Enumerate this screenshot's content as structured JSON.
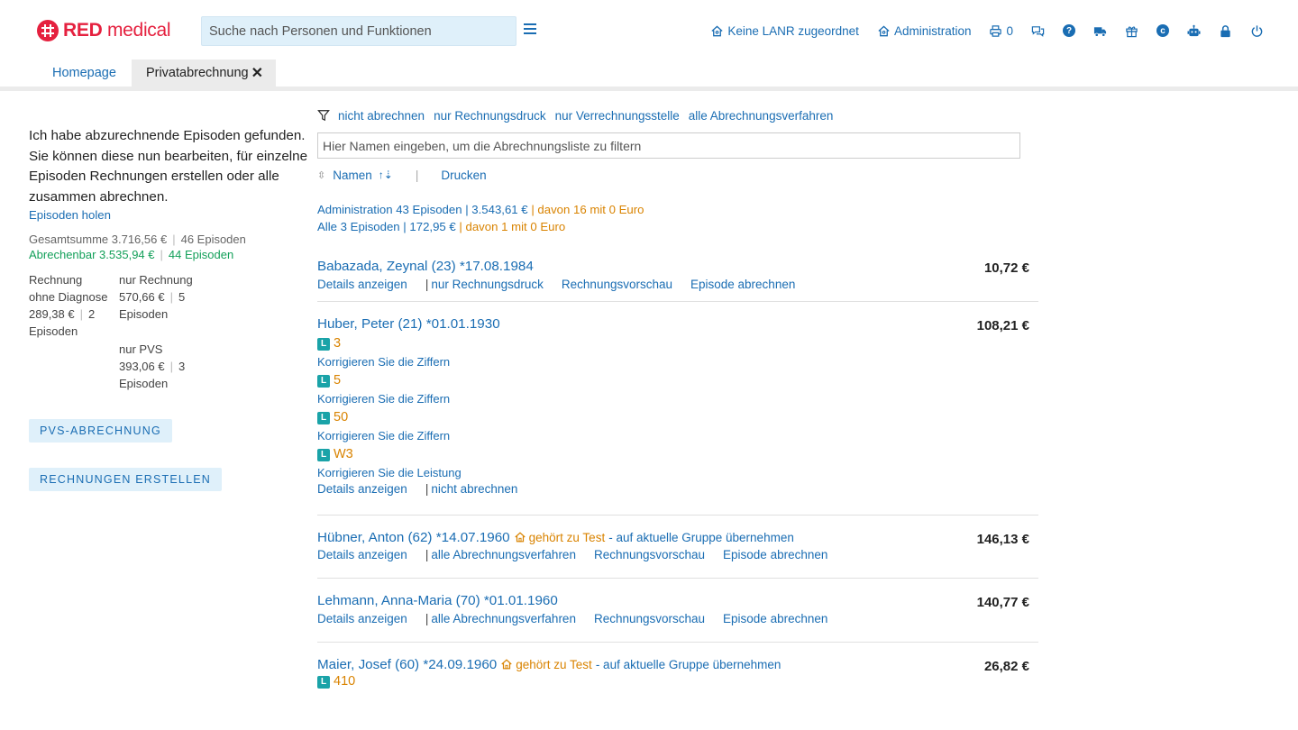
{
  "app": {
    "logo_bold": "RED",
    "logo_light": " medical"
  },
  "search": {
    "placeholder": "Suche nach Personen und Funktionen"
  },
  "toolbar": {
    "lanr": "Keine LANR zugeordnet",
    "administration": "Administration",
    "print_count": "0"
  },
  "tabs": [
    {
      "label": "Homepage"
    },
    {
      "label": "Privatabrechnung"
    }
  ],
  "left": {
    "intro": "Ich habe abzurechnende Episoden gefunden. Sie können diese nun bearbeiten, für einzelne Episoden Rechnungen erstellen oder alle zusammen abrechnen.",
    "get_episodes": "Episoden holen",
    "total_label": "Gesamtsumme 3.716,56 €",
    "total_episodes": "46 Episoden",
    "billable_label": "Abrechenbar 3.535,94 €",
    "billable_episodes": "44 Episoden",
    "col1": {
      "label_l1": "Rechnung",
      "label_l2": "ohne Diagnose",
      "amount": "289,38 €",
      "count": "2",
      "unit": "Episoden"
    },
    "col2a": {
      "label": "nur Rechnung",
      "amount": "570,66 €",
      "count": "5",
      "unit": "Episoden"
    },
    "col2b": {
      "label": "nur PVS",
      "amount": "393,06 €",
      "count": "3",
      "unit": "Episoden"
    },
    "btn_pvs": "PVS-ABRECHNUNG",
    "btn_invoices": "RECHNUNGEN ERSTELLEN"
  },
  "main": {
    "filters": [
      "nicht abrechnen",
      "nur Rechnungsdruck",
      "nur Verrechnungsstelle",
      "alle Abrechnungsverfahren"
    ],
    "filter_placeholder": "Hier Namen eingeben, um die Abrechnungsliste zu filtern",
    "sort_label": "Namen",
    "print_label": "Drucken",
    "summary1_main": "Administration 43 Episoden | 3.543,61 €",
    "summary1_zero": "davon 16 mit 0 Euro",
    "summary2_main": "Alle 3 Episoden | 172,95 €",
    "summary2_zero": "davon 1 mit 0 Euro"
  },
  "entries": [
    {
      "name": "Babazada, Zeynal (23) *17.08.1984",
      "price": "10,72 €",
      "details": "Details anzeigen",
      "mode": "nur Rechnungsdruck",
      "preview": "Rechnungsvorschau",
      "bill": "Episode abrechnen"
    },
    {
      "name": "Huber, Peter (21) *01.01.1930",
      "price": "108,21 €",
      "codes": [
        {
          "badge": "L",
          "code": "3",
          "hint": "Korrigieren Sie die Ziffern"
        },
        {
          "badge": "L",
          "code": "5",
          "hint": "Korrigieren Sie die Ziffern"
        },
        {
          "badge": "L",
          "code": "50",
          "hint": "Korrigieren Sie die Ziffern"
        },
        {
          "badge": "L",
          "code": "W3",
          "hint": "Korrigieren Sie die Leistung"
        }
      ],
      "details": "Details anzeigen",
      "mode": "nicht abrechnen"
    },
    {
      "name": "Hübner, Anton (62) *14.07.1960",
      "group": "gehört zu Test",
      "group_action": "- auf aktuelle Gruppe übernehmen",
      "price": "146,13 €",
      "details": "Details anzeigen",
      "mode": "alle Abrechnungsverfahren",
      "preview": "Rechnungsvorschau",
      "bill": "Episode abrechnen"
    },
    {
      "name": "Lehmann, Anna-Maria (70) *01.01.1960",
      "price": "140,77 €",
      "details": "Details anzeigen",
      "mode": "alle Abrechnungsverfahren",
      "preview": "Rechnungsvorschau",
      "bill": "Episode abrechnen"
    },
    {
      "name": "Maier, Josef (60) *24.09.1960",
      "group": "gehört zu Test",
      "group_action": "- auf aktuelle Gruppe übernehmen",
      "price": "26,82 €",
      "code_badge": "L",
      "code": "410"
    }
  ]
}
